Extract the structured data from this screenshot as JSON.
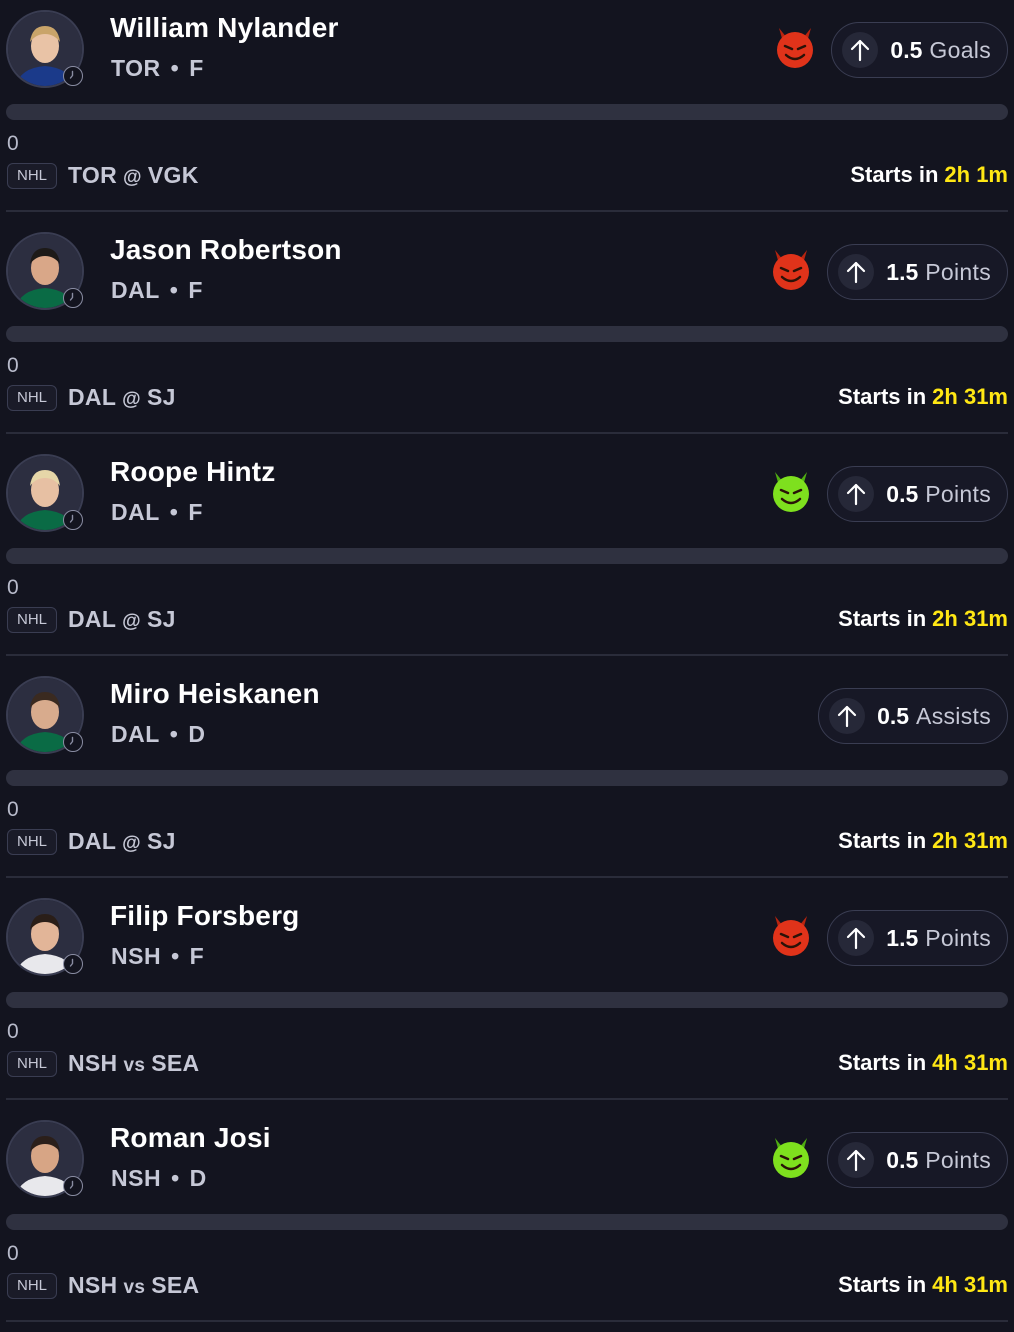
{
  "colors": {
    "background": "#13141f",
    "accent_time": "#ffe714",
    "demon_red": "#e0331a",
    "demon_green": "#7ee01e"
  },
  "items": [
    {
      "player": "William Nylander",
      "team": "TOR",
      "position": "F",
      "line": "0.5",
      "stat": "Goals",
      "direction": "over",
      "emoji": "red-demon-icon",
      "progress": 0,
      "count": "0",
      "league": "NHL",
      "home": "TOR",
      "sep": "@",
      "away": "VGK",
      "starts_label": "Starts in",
      "time": "2h 1m"
    },
    {
      "player": "Jason Robertson",
      "team": "DAL",
      "position": "F",
      "line": "1.5",
      "stat": "Points",
      "direction": "over",
      "emoji": "red-demon-icon",
      "progress": 0,
      "count": "0",
      "league": "NHL",
      "home": "DAL",
      "sep": "@",
      "away": "SJ",
      "starts_label": "Starts in",
      "time": "2h 31m"
    },
    {
      "player": "Roope Hintz",
      "team": "DAL",
      "position": "F",
      "line": "0.5",
      "stat": "Points",
      "direction": "over",
      "emoji": "green-demon-icon",
      "progress": 0,
      "count": "0",
      "league": "NHL",
      "home": "DAL",
      "sep": "@",
      "away": "SJ",
      "starts_label": "Starts in",
      "time": "2h 31m"
    },
    {
      "player": "Miro Heiskanen",
      "team": "DAL",
      "position": "D",
      "line": "0.5",
      "stat": "Assists",
      "direction": "over",
      "emoji": "",
      "progress": 0,
      "count": "0",
      "league": "NHL",
      "home": "DAL",
      "sep": "@",
      "away": "SJ",
      "starts_label": "Starts in",
      "time": "2h 31m"
    },
    {
      "player": "Filip Forsberg",
      "team": "NSH",
      "position": "F",
      "line": "1.5",
      "stat": "Points",
      "direction": "over",
      "emoji": "red-demon-icon",
      "progress": 0,
      "count": "0",
      "league": "NHL",
      "home": "NSH",
      "sep": "vs",
      "away": "SEA",
      "starts_label": "Starts in",
      "time": "4h 31m"
    },
    {
      "player": "Roman Josi",
      "team": "NSH",
      "position": "D",
      "line": "0.5",
      "stat": "Points",
      "direction": "over",
      "emoji": "green-demon-icon",
      "progress": 0,
      "count": "0",
      "league": "NHL",
      "home": "NSH",
      "sep": "vs",
      "away": "SEA",
      "starts_label": "Starts in",
      "time": "4h 31m"
    }
  ]
}
